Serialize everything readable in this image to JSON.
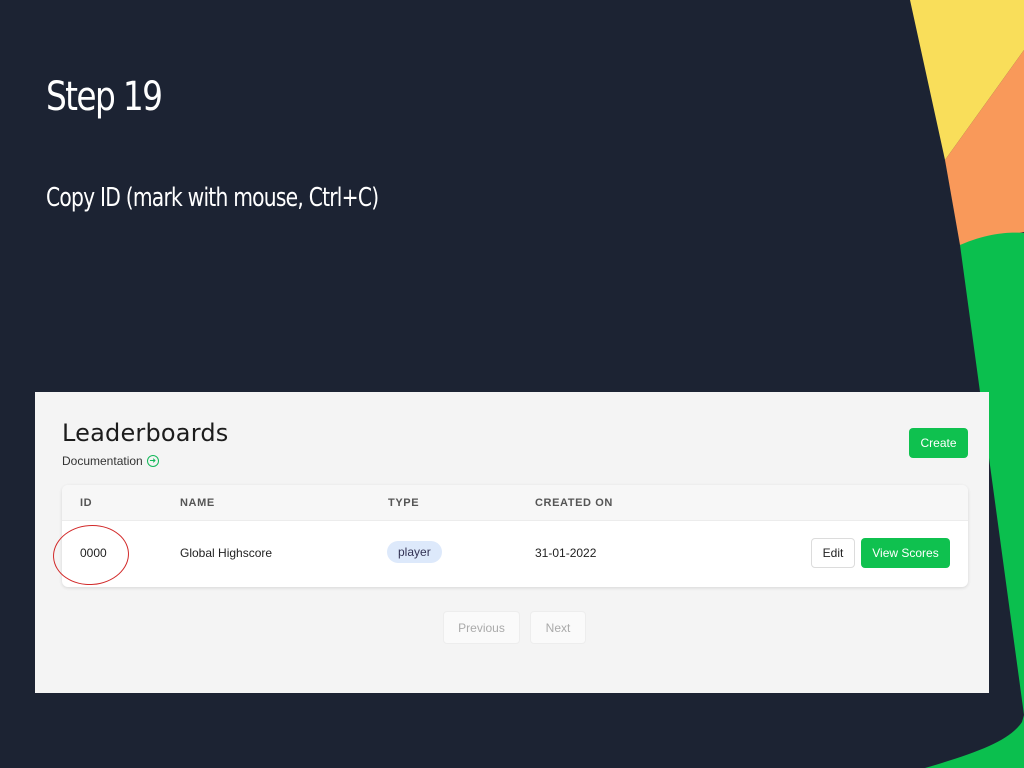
{
  "slide": {
    "title": "Step 19",
    "instruction": "Copy ID (mark with mouse, Ctrl+C)"
  },
  "leaderboards": {
    "heading": "Leaderboards",
    "documentation_link": "Documentation",
    "create_button": "Create",
    "columns": [
      "ID",
      "NAME",
      "TYPE",
      "CREATED ON"
    ],
    "rows": [
      {
        "id": "0000",
        "name": "Global Highscore",
        "type": "player",
        "created_on": "31-01-2022",
        "edit_label": "Edit",
        "view_scores_label": "View Scores"
      }
    ],
    "pagination": {
      "previous": "Previous",
      "next": "Next"
    }
  },
  "colors": {
    "background": "#1c2333",
    "accent_green": "#0fc14f",
    "deco_yellow": "#f9de5a",
    "deco_orange": "#f9995a",
    "deco_green": "#0bbf4e",
    "annotation_red": "#d22a2a"
  },
  "icons": {
    "documentation_link_icon": "arrow-right-circle-icon"
  }
}
